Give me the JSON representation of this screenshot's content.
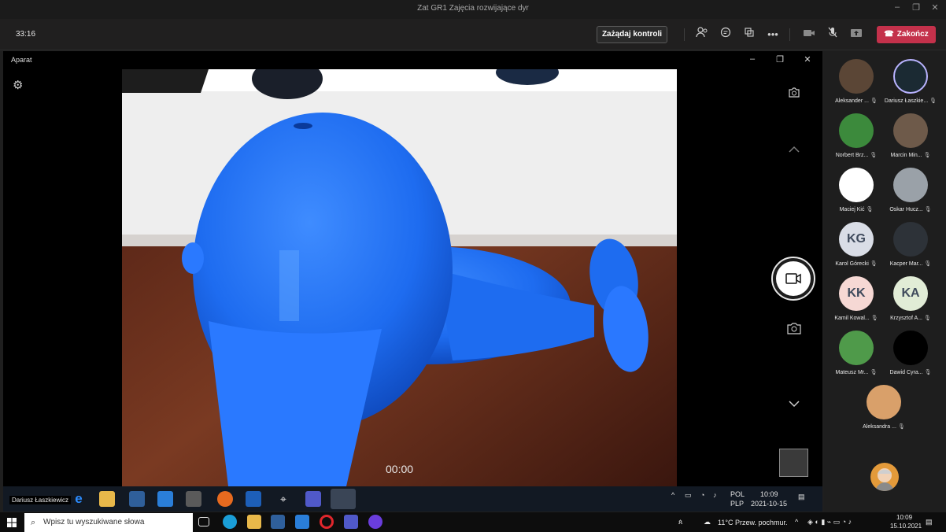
{
  "window": {
    "title": "Zat GR1 Zajęcia rozwijające dyr"
  },
  "meeting": {
    "timer": "33:16",
    "take_control_label": "Zażądaj kontroli",
    "end_label": "Zakończ"
  },
  "camera": {
    "app_title": "Aparat",
    "record_time": "00:00"
  },
  "participants": [
    {
      "name": "Aleksander ...",
      "initials": "",
      "color": "#5b4636"
    },
    {
      "name": "Dariusz Łaszkie...",
      "initials": "",
      "color": "#1b2a33"
    },
    {
      "name": "Norbert Brz...",
      "initials": "",
      "color": "#3c8a3c"
    },
    {
      "name": "Marcin Min...",
      "initials": "",
      "color": "#6e5a4a"
    },
    {
      "name": "Maciej Kić",
      "initials": "",
      "color": "#ffffff"
    },
    {
      "name": "Oskar Hucz...",
      "initials": "",
      "color": "#9aa1a8"
    },
    {
      "name": "Karol Górecki",
      "initials": "KG",
      "color": "#d9dde6"
    },
    {
      "name": "Kacper Mar...",
      "initials": "",
      "color": "#2d3238"
    },
    {
      "name": "Kamil Kowal...",
      "initials": "KK",
      "color": "#f6d8d4"
    },
    {
      "name": "Krzysztof A...",
      "initials": "KA",
      "color": "#e1ecd6"
    },
    {
      "name": "Mateusz Mr...",
      "initials": "",
      "color": "#4f9a4a"
    },
    {
      "name": "Dawid Cyra...",
      "initials": "",
      "color": "#000000"
    },
    {
      "name": "Aleksandra ...",
      "initials": "",
      "color": "#d9a06a"
    }
  ],
  "shared_taskbar": {
    "user_label": "Dariusz Łaszkiewicz",
    "lang_top": "POL",
    "lang_bottom": "PLP",
    "time": "10:09",
    "date": "2021-10-15"
  },
  "taskbar": {
    "search_placeholder": "Wpisz tu wyszukiwane słowa",
    "weather": "11°C  Przew. pochmur.",
    "time": "10:09",
    "date": "15.10.2021"
  },
  "colors": {
    "end_button": "#c4314b",
    "model_blue": "#1e6cf0"
  }
}
